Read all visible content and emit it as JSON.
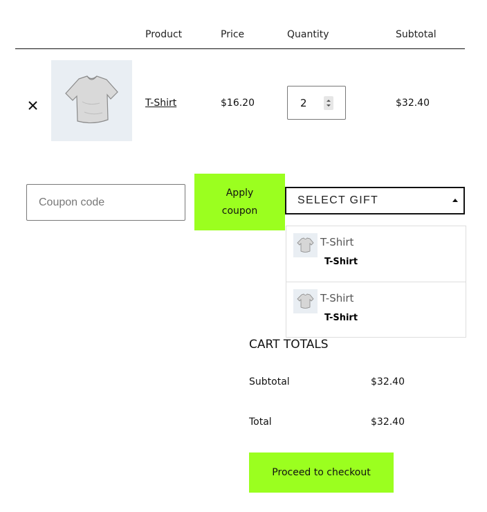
{
  "table": {
    "headers": {
      "product": "Product",
      "price": "Price",
      "quantity": "Quantity",
      "subtotal": "Subtotal"
    }
  },
  "cart_item": {
    "remove_icon": "close-icon",
    "name": "T-Shirt",
    "price": "$16.20",
    "quantity": "2",
    "subtotal": "$32.40"
  },
  "coupon": {
    "placeholder": "Coupon code",
    "apply_line1": "Apply",
    "apply_line2": "coupon"
  },
  "gift": {
    "select_label": "SELECT GIFT",
    "options": [
      {
        "name": "T-Shirt",
        "title": "T-Shirt"
      },
      {
        "name": "T-Shirt",
        "title": "T-Shirt"
      }
    ]
  },
  "totals": {
    "title": "CART TOTALS",
    "subtotal_label": "Subtotal",
    "subtotal_value": "$32.40",
    "total_label": "Total",
    "total_value": "$32.40"
  },
  "checkout": {
    "label": "Proceed to checkout"
  },
  "colors": {
    "accent": "#9bff1f",
    "thumb_bg": "#e9eef3"
  }
}
